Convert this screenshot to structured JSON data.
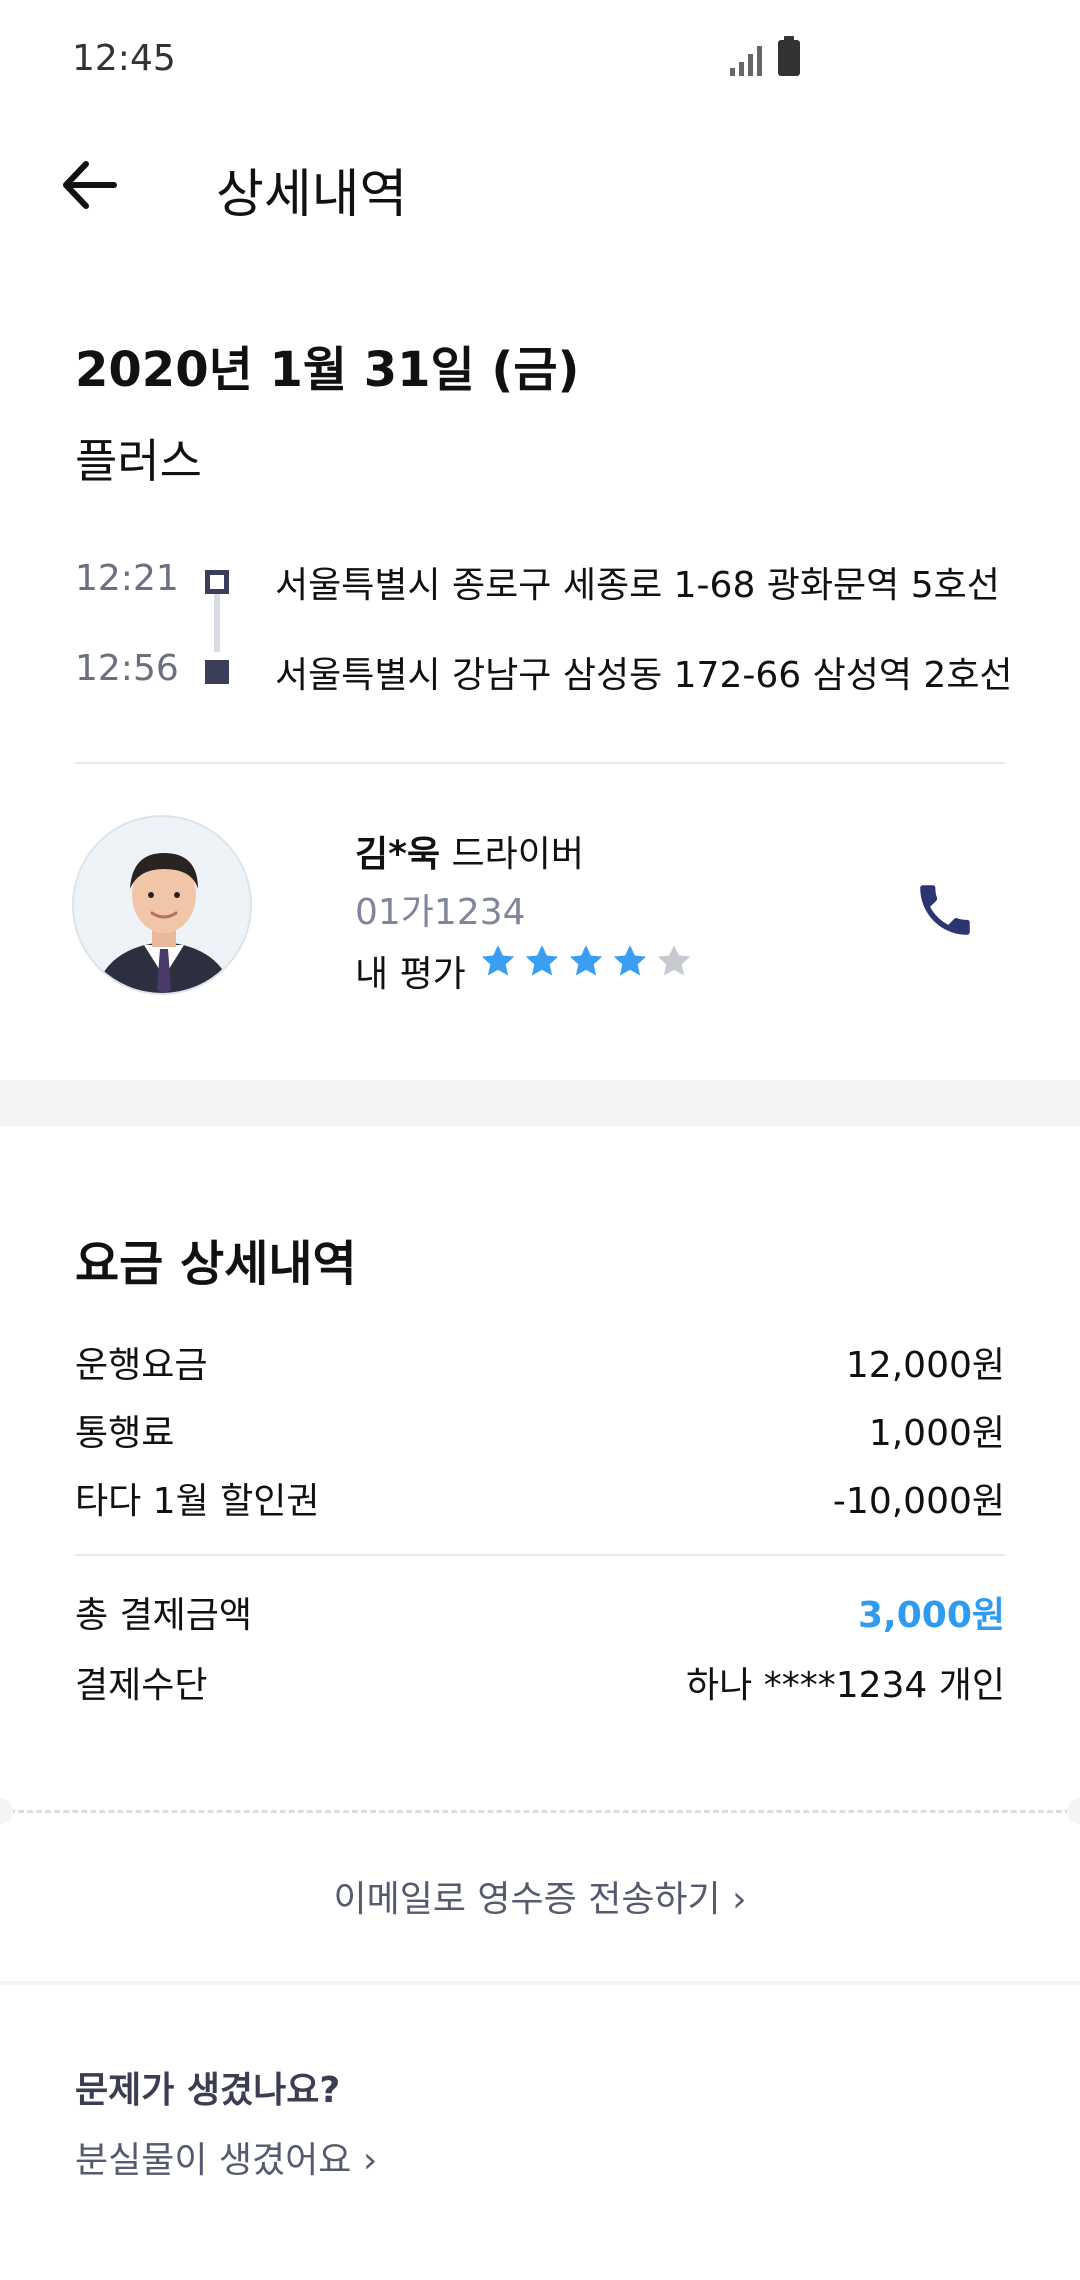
{
  "status_bar": {
    "time": "12:45"
  },
  "header": {
    "title": "상세내역"
  },
  "trip": {
    "date": "2020년 1월 31일 (금)",
    "service": "플러스",
    "route": [
      {
        "time": "12:21",
        "address": "서울특별시 종로구 세종로 1-68 광화문역 5호선"
      },
      {
        "time": "12:56",
        "address": "서울특별시 강남구 삼성동 172-66 삼성역 2호선"
      }
    ]
  },
  "driver": {
    "name": "김*욱",
    "suffix": " 드라이버",
    "car_number": "01가1234",
    "rating_label": "내 평가",
    "rating": 4,
    "rating_max": 5
  },
  "fare": {
    "title": "요금 상세내역",
    "items": [
      {
        "label": "운행요금",
        "value": "12,000원"
      },
      {
        "label": "통행료",
        "value": "1,000원"
      },
      {
        "label": "타다 1월 할인권",
        "value": "-10,000원"
      }
    ],
    "total": {
      "label": "총 결제금액",
      "value": "3,000원"
    },
    "payment": {
      "label": "결제수단",
      "value": "하나 ****1234 개인"
    },
    "receipt_link": "이메일로 영수증 전송하기 ›"
  },
  "problem": {
    "title": "문제가 생겼나요?",
    "lost_link": "분실물이 생겼어요 ›"
  },
  "colors": {
    "accent": "#2f9bf0",
    "phone_icon": "#2c3570",
    "star_on": "#3a9ef5",
    "star_off": "#c7c9d1"
  }
}
